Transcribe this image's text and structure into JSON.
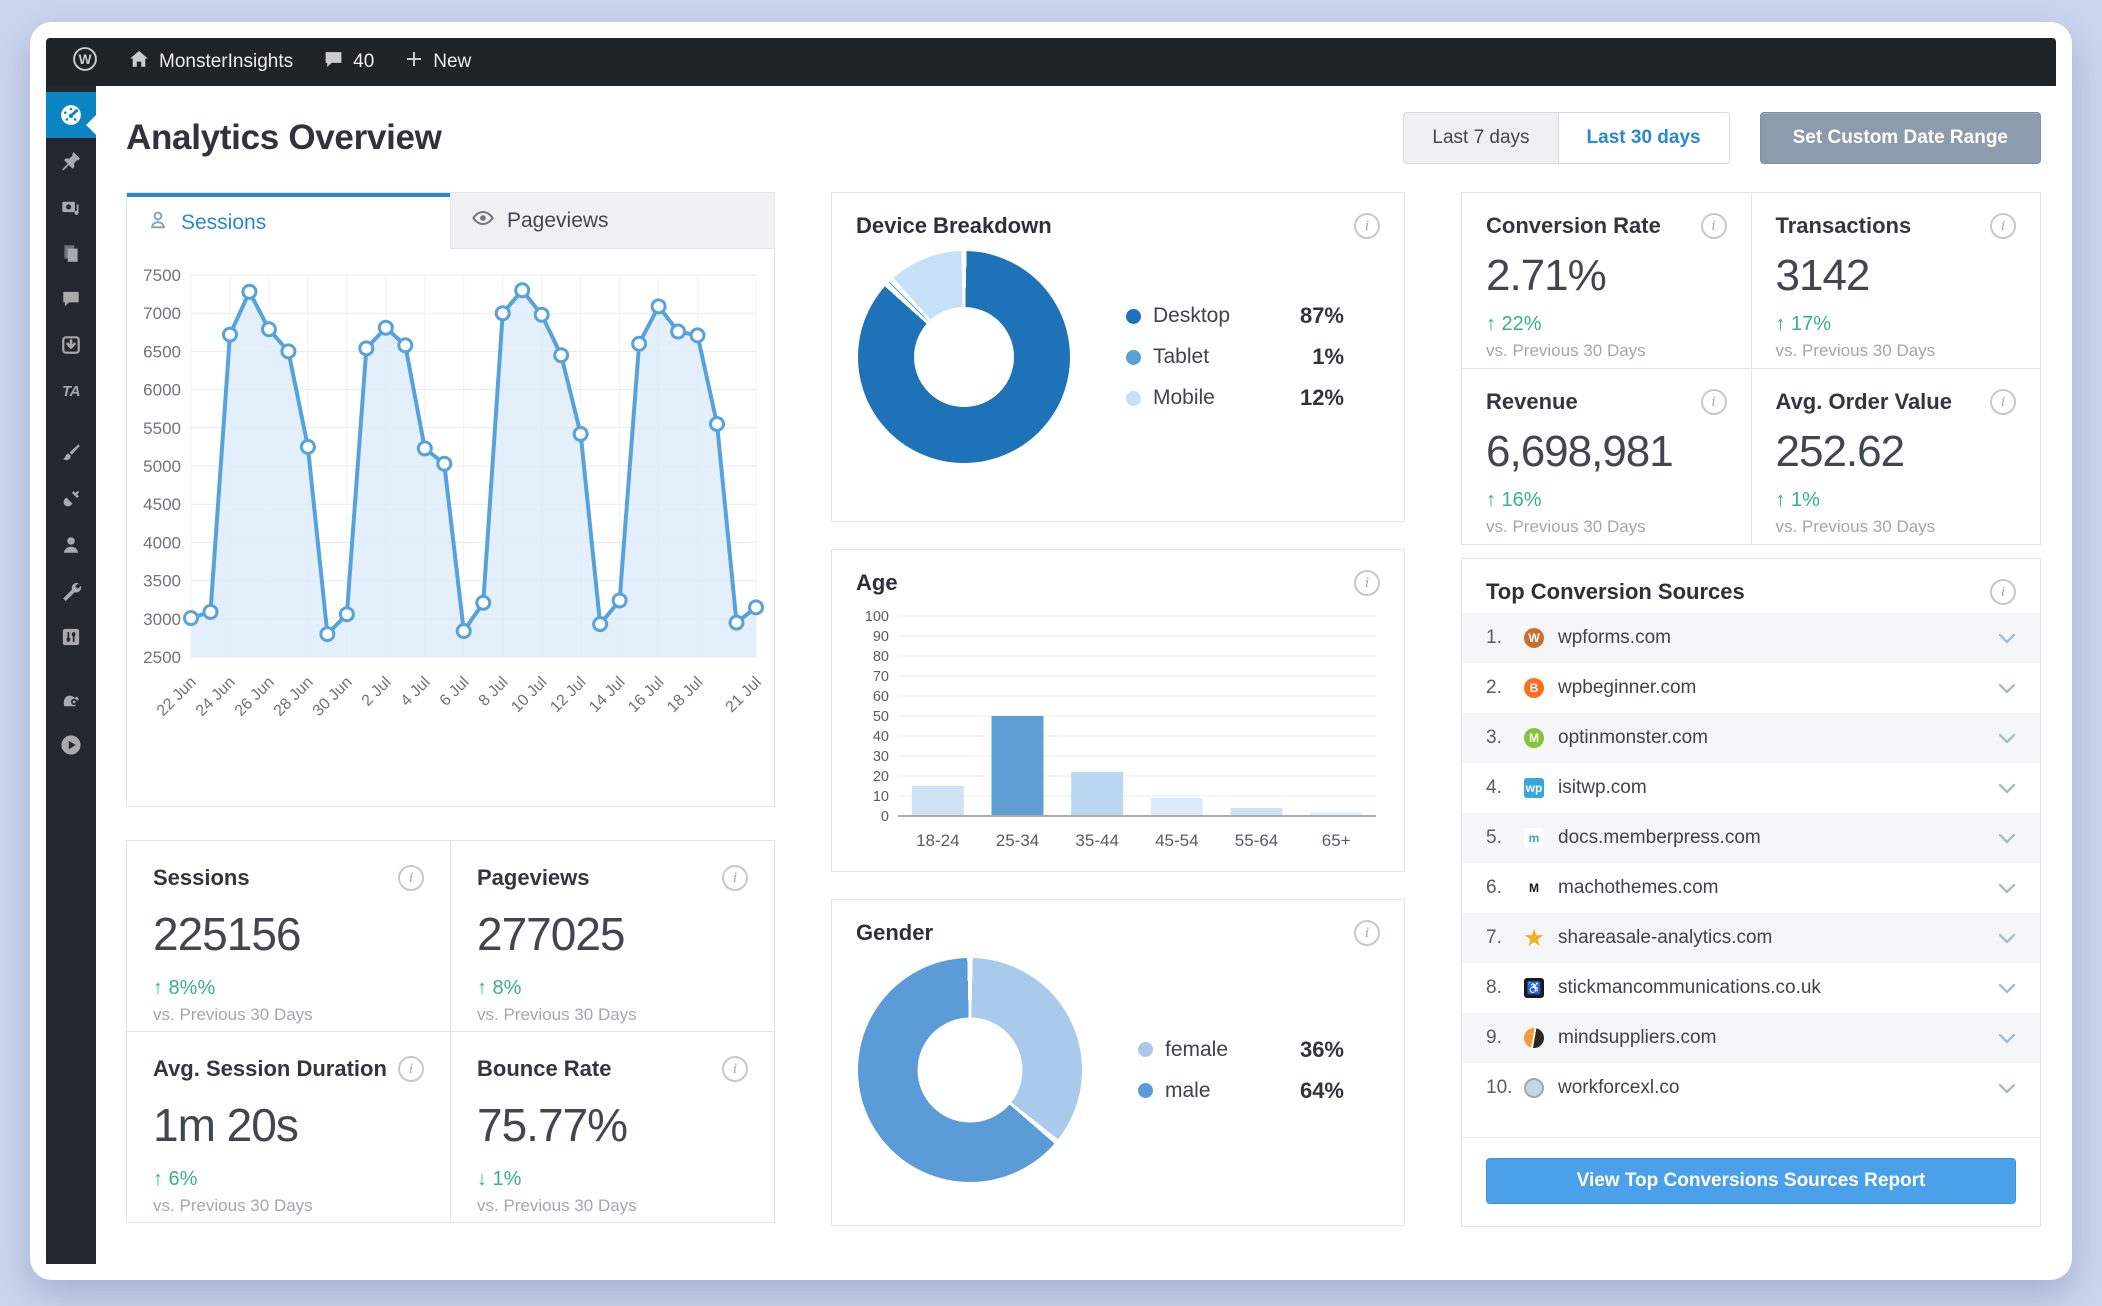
{
  "admin_bar": {
    "site": "MonsterInsights",
    "comments": "40",
    "new_label": "New"
  },
  "sidebar": {
    "ta_label": "TA",
    "icons": [
      "dashboard",
      "posts-pin",
      "media",
      "pages",
      "comments",
      "downloads",
      "thirstyaffiliates",
      "appearance-brush",
      "plugins-plug",
      "users",
      "tools-wrench",
      "settings-sliders",
      "monsterinsights-monster",
      "video-play"
    ]
  },
  "header": {
    "title": "Analytics Overview",
    "range7": "Last 7 days",
    "range30": "Last 30 days",
    "custom": "Set Custom Date Range"
  },
  "tabs": [
    {
      "label": "Sessions"
    },
    {
      "label": "Pageviews"
    }
  ],
  "chart_data": [
    {
      "type": "line",
      "title": "Sessions",
      "x": [
        "22 Jun",
        "23 Jun",
        "24 Jun",
        "25 Jun",
        "26 Jun",
        "27 Jun",
        "28 Jun",
        "29 Jun",
        "30 Jun",
        "1 Jul",
        "2 Jul",
        "3 Jul",
        "4 Jul",
        "5 Jul",
        "6 Jul",
        "7 Jul",
        "8 Jul",
        "9 Jul",
        "10 Jul",
        "11 Jul",
        "12 Jul",
        "13 Jul",
        "14 Jul",
        "15 Jul",
        "16 Jul",
        "17 Jul",
        "18 Jul",
        "19 Jul",
        "20 Jul",
        "21 Jul"
      ],
      "values": [
        3010,
        3090,
        6720,
        7280,
        6790,
        6500,
        5250,
        2800,
        3060,
        6540,
        6810,
        6580,
        5230,
        5030,
        2840,
        3210,
        7000,
        7300,
        6980,
        6450,
        5420,
        2930,
        3240,
        6600,
        7090,
        6760,
        6710,
        5550,
        2950,
        3150
      ],
      "ylim": [
        2500,
        7500
      ],
      "ytick": 500,
      "xtick_idx": [
        0,
        2,
        4,
        6,
        8,
        10,
        12,
        14,
        16,
        18,
        20,
        22,
        24,
        26,
        29
      ],
      "xtick_labels": [
        "22 Jun",
        "24 Jun",
        "26 Jun",
        "28 Jun",
        "30 Jun",
        "2 Jul",
        "4 Jul",
        "6 Jul",
        "8 Jul",
        "10 Jul",
        "12 Jul",
        "14 Jul",
        "16 Jul",
        "18 Jul",
        "21 Jul"
      ],
      "line_color": "#57a2dc",
      "fill_color": "#dcebf9",
      "grid": true
    },
    {
      "type": "pie",
      "title": "Device Breakdown",
      "labels": [
        "Desktop",
        "Tablet",
        "Mobile"
      ],
      "values": [
        87,
        1,
        12
      ],
      "legend_values": [
        "87%",
        "1%",
        "12%"
      ],
      "colors": [
        "#1d72b8",
        "#57a0d8",
        "#c6e0f8"
      ],
      "legend_position": "right"
    },
    {
      "type": "bar",
      "title": "Age",
      "categories": [
        "18-24",
        "25-34",
        "35-44",
        "45-54",
        "55-64",
        "65+"
      ],
      "values": [
        15,
        50,
        22,
        9,
        4,
        2
      ],
      "colors": [
        "#cee3f6",
        "#5f9fd6",
        "#b9d7f1",
        "#ddeaf8",
        "#cfe2f5",
        "#e3effa"
      ],
      "ylim": [
        0,
        100
      ],
      "ytick": 10,
      "grid": true
    },
    {
      "type": "pie",
      "title": "Gender",
      "labels": [
        "female",
        "male"
      ],
      "values": [
        36,
        64
      ],
      "legend_values": [
        "36%",
        "64%"
      ],
      "colors": [
        "#a9caea",
        "#5b9bd8"
      ],
      "legend_position": "right"
    }
  ],
  "stats_left": [
    {
      "title": "Sessions",
      "value": "225156",
      "dir": "up",
      "change": "8%%",
      "note": "vs. Previous 30 Days"
    },
    {
      "title": "Pageviews",
      "value": "277025",
      "dir": "up",
      "change": "8%",
      "note": "vs. Previous 30 Days"
    },
    {
      "title": "Avg. Session Duration",
      "value": "1m 20s",
      "dir": "up",
      "change": "6%",
      "note": "vs. Previous 30 Days"
    },
    {
      "title": "Bounce Rate",
      "value": "75.77%",
      "dir": "down",
      "change": "1%",
      "note": "vs. Previous 30 Days"
    }
  ],
  "stats_right": [
    {
      "title": "Conversion Rate",
      "value": "2.71%",
      "dir": "up",
      "change": "22%",
      "note": "vs. Previous 30 Days"
    },
    {
      "title": "Transactions",
      "value": "3142",
      "dir": "up",
      "change": "17%",
      "note": "vs. Previous 30 Days"
    },
    {
      "title": "Revenue",
      "value": "6,698,981",
      "dir": "up",
      "change": "16%",
      "note": "vs. Previous 30 Days"
    },
    {
      "title": "Avg. Order Value",
      "value": "252.62",
      "dir": "up",
      "change": "1%",
      "note": "vs. Previous 30 Days"
    }
  ],
  "top_sources": {
    "title": "Top Conversion Sources",
    "button": "View Top Conversions Sources Report",
    "items": [
      {
        "rank": "1.",
        "domain": "wpforms.com",
        "favicon": {
          "glyph": "W",
          "bg": "#c96f2f",
          "fg": "#ffffff",
          "shape": "round"
        }
      },
      {
        "rank": "2.",
        "domain": "wpbeginner.com",
        "favicon": {
          "glyph": "B",
          "bg": "#ff6e1f",
          "fg": "#ffffff",
          "shape": "round"
        }
      },
      {
        "rank": "3.",
        "domain": "optinmonster.com",
        "favicon": {
          "glyph": "M",
          "bg": "#87c337",
          "fg": "#ffffff",
          "shape": "round"
        }
      },
      {
        "rank": "4.",
        "domain": "isitwp.com",
        "favicon": {
          "glyph": "wp",
          "bg": "#35a7dc",
          "fg": "#ffffff",
          "shape": "square"
        }
      },
      {
        "rank": "5.",
        "domain": "docs.memberpress.com",
        "favicon": {
          "glyph": "m",
          "bg": "#ffffff",
          "fg": "#2ba8e0",
          "shape": "square"
        }
      },
      {
        "rank": "6.",
        "domain": "machothemes.com",
        "favicon": {
          "glyph": "M",
          "bg": "#ffffff",
          "fg": "#141414",
          "shape": "square"
        }
      },
      {
        "rank": "7.",
        "domain": "shareasale-analytics.com",
        "favicon": {
          "glyph": "★",
          "bg": "transparent",
          "fg": "#f2b01e",
          "shape": "none"
        }
      },
      {
        "rank": "8.",
        "domain": "stickmancommunications.co.uk",
        "favicon": {
          "glyph": "♿",
          "bg": "#1a1a1a",
          "fg": "#ffffff",
          "shape": "square"
        }
      },
      {
        "rank": "9.",
        "domain": "mindsuppliers.com",
        "favicon": {
          "glyph": "",
          "bg": "linear-gradient(100deg,#f29c38 0 45%,#ffffff 45% 53%,#2b2723 53% 100%)",
          "fg": "#000000",
          "shape": "round"
        }
      },
      {
        "rank": "10.",
        "domain": "workforcexl.co",
        "favicon": {
          "glyph": "",
          "bg": "#c9d4e2",
          "fg": "#8795a5",
          "shape": "round",
          "border": "#9aa9bc"
        }
      }
    ]
  }
}
